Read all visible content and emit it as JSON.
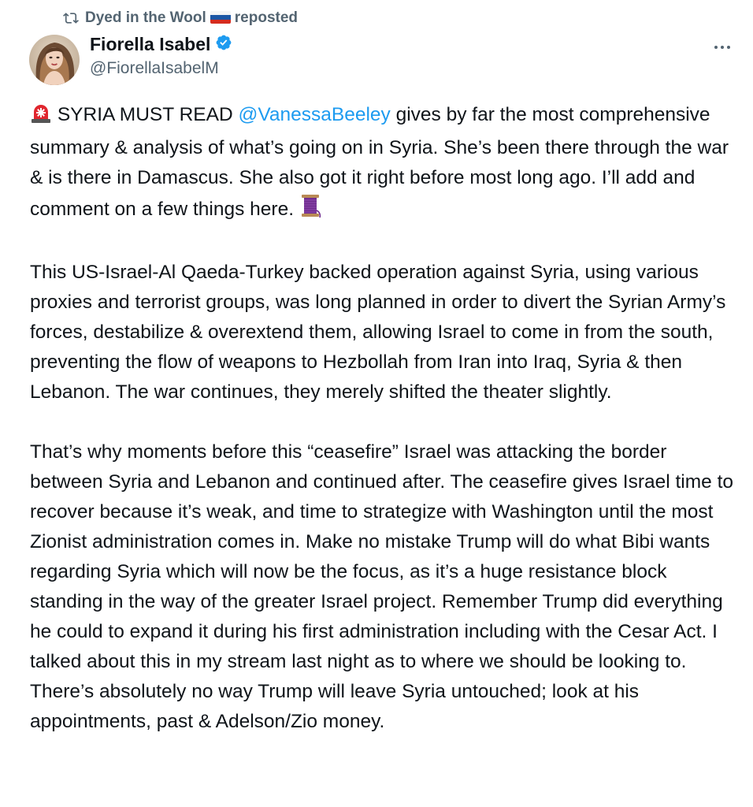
{
  "repost": {
    "reposter_name": "Dyed in the Wool",
    "flag": "russia-flag",
    "suffix": "reposted"
  },
  "author": {
    "display_name": "Fiorella Isabel",
    "handle": "@FiorellaIsabelM",
    "verified": true,
    "verified_color": "#1d9bf0"
  },
  "tweet": {
    "p1": {
      "emoji_start": "rotating-light-emoji",
      "text_before_mention": "SYRIA MUST READ ",
      "mention": "@VanessaBeeley",
      "text_after_mention": " gives by far the most comprehensive summary & analysis of what’s going on in Syria. She’s been there through the war & is there in Damascus. She also got it right before most long ago. I’ll add and comment on a few things here. ",
      "emoji_end": "thread-emoji"
    },
    "p2": "This US-Israel-Al Qaeda-Turkey backed operation against Syria, using various proxies and terrorist groups, was long planned in order to divert the Syrian Army’s forces, destabilize & overextend them, allowing Israel to come in from the south, preventing the flow of weapons to Hezbollah from Iran into Iraq, Syria & then Lebanon. The war continues, they merely shifted the theater slightly.",
    "p3": "That’s why moments before this “ceasefire” Israel was attacking the border between Syria and Lebanon and continued after. The ceasefire gives Israel time to recover because it’s weak, and time to strategize with Washington until the most Zionist administration comes in. Make no mistake Trump will do what Bibi wants regarding Syria which will now be the focus, as it’s a huge resistance block standing in the way of the greater Israel project. Remember Trump did everything he could to expand it during his first administration including with the Cesar Act. I talked about this in my stream last night as to where we should be looking to. There’s absolutely no way Trump will leave Syria untouched; look at his appointments, past & Adelson/Zio money."
  },
  "colors": {
    "text": "#0f1419",
    "secondary": "#536471",
    "link": "#1d9bf0"
  }
}
